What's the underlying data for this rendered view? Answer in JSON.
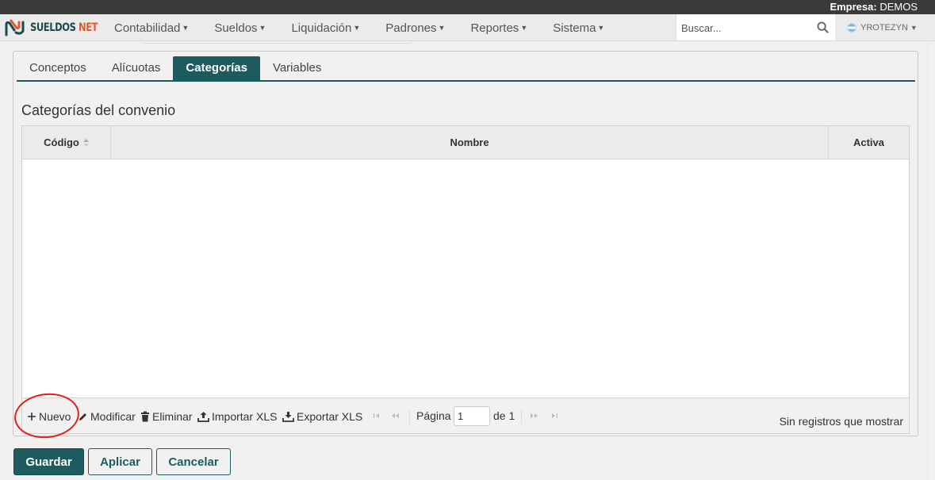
{
  "topbar": {
    "empresa_label": "Empresa:",
    "empresa_value": "DEMOS"
  },
  "brand": {
    "part1": "SUELDOS",
    "part2": " NET",
    "colors": {
      "dark": "#1e4a4f",
      "accent": "#e05a2c"
    }
  },
  "menu": [
    {
      "label": "Contabilidad"
    },
    {
      "label": "Sueldos"
    },
    {
      "label": "Liquidación"
    },
    {
      "label": "Padrones"
    },
    {
      "label": "Reportes"
    },
    {
      "label": "Sistema"
    }
  ],
  "search": {
    "placeholder": "Buscar..."
  },
  "user": {
    "name": "YROTEZYN"
  },
  "tabs": [
    {
      "label": "Conceptos",
      "active": false
    },
    {
      "label": "Alícuotas",
      "active": false
    },
    {
      "label": "Categorías",
      "active": true
    },
    {
      "label": "Variables",
      "active": false
    }
  ],
  "section": {
    "title": "Categorías del convenio"
  },
  "grid": {
    "columns": [
      {
        "label": "Código",
        "sortable": true
      },
      {
        "label": "Nombre"
      },
      {
        "label": "Activa"
      }
    ],
    "rows": []
  },
  "pager": {
    "nuevo": "Nuevo",
    "modificar": "Modificar",
    "eliminar": "Eliminar",
    "importar": "Importar XLS",
    "exportar": "Exportar XLS",
    "page_label": "Página",
    "page_value": "1",
    "of_label": "de 1",
    "no_records": "Sin registros que mostrar"
  },
  "actions": {
    "guardar": "Guardar",
    "aplicar": "Aplicar",
    "cancelar": "Cancelar"
  },
  "theme": {
    "primary": "#1e5b5f",
    "highlight": "#e02020"
  }
}
